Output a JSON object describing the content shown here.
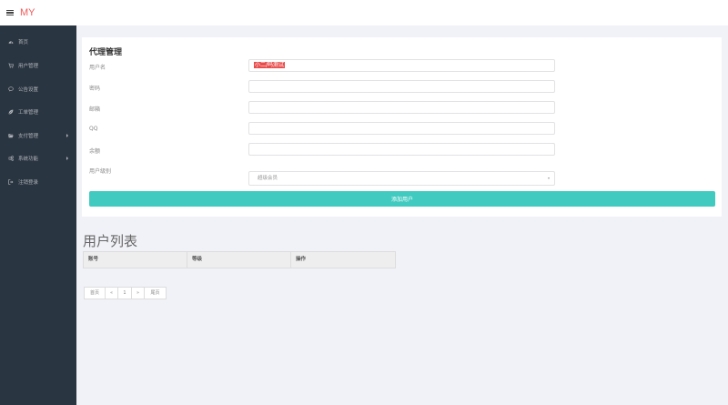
{
  "header": {
    "brand": "MY",
    "menu_icon": "hamburger-icon"
  },
  "colors": {
    "sidebar": "#2a3542",
    "brand": "#ef5a5a",
    "accent": "#41cac0",
    "highlight": "#e84d4d"
  },
  "sidebar": {
    "items": [
      {
        "label": "首页",
        "icon": "dashboard-icon"
      },
      {
        "label": "用户管理",
        "icon": "cart-icon"
      },
      {
        "label": "公告设置",
        "icon": "comment-icon"
      },
      {
        "label": "工单管理",
        "icon": "leaf-icon"
      },
      {
        "label": "支付管理",
        "icon": "folder-open-icon",
        "has_submenu": true
      },
      {
        "label": "系统功能",
        "icon": "gears-icon",
        "has_submenu": true
      },
      {
        "label": "注销登录",
        "icon": "sign-out-icon"
      }
    ]
  },
  "form": {
    "title": "代理管理",
    "fields": [
      {
        "label": "用户名",
        "value": "小二/吗测试"
      },
      {
        "label": "密码",
        "value": ""
      },
      {
        "label": "邮箱",
        "value": ""
      },
      {
        "label": "QQ",
        "value": ""
      },
      {
        "label": "余额",
        "value": ""
      }
    ],
    "level": {
      "label": "用户级别",
      "selected": "超级会员"
    },
    "submit_label": "添加用户"
  },
  "user_list": {
    "title": "用户列表",
    "columns": [
      "账号",
      "等级",
      "操作"
    ],
    "rows": []
  },
  "pagination": {
    "first": "首页",
    "prev": "«",
    "current": "1",
    "next": "»",
    "last": "尾页"
  }
}
